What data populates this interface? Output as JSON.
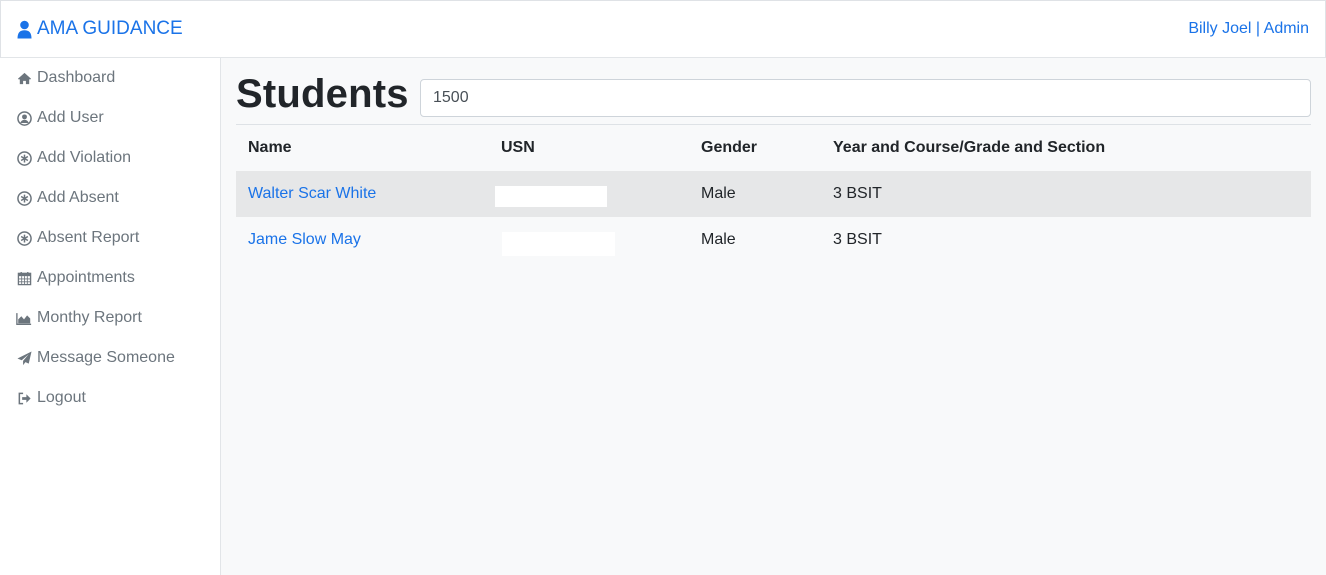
{
  "navbar": {
    "brand": "AMA GUIDANCE",
    "brand_icon": "user-icon",
    "user_name": "Billy Joel",
    "separator": " | ",
    "user_role": "Admin",
    "accent_color": "#1a73e8"
  },
  "sidebar": {
    "items": [
      {
        "label": "Dashboard",
        "icon": "home-icon"
      },
      {
        "label": "Add User",
        "icon": "user-circle-icon"
      },
      {
        "label": "Add Violation",
        "icon": "asterisk-circle-icon"
      },
      {
        "label": "Add Absent",
        "icon": "asterisk-circle-icon"
      },
      {
        "label": "Absent Report",
        "icon": "asterisk-circle-icon"
      },
      {
        "label": "Appointments",
        "icon": "calendar-icon"
      },
      {
        "label": "Monthy Report",
        "icon": "area-chart-icon"
      },
      {
        "label": "Message Someone",
        "icon": "paper-plane-icon"
      },
      {
        "label": "Logout",
        "icon": "sign-out-icon"
      }
    ]
  },
  "main": {
    "title": "Students",
    "search_value": "1500",
    "table": {
      "headers": [
        "Name",
        "USN",
        "Gender",
        "Year and Course/Grade and Section"
      ],
      "rows": [
        {
          "name": "Walter Scar White",
          "usn": "",
          "gender": "Male",
          "year_course": "3 BSIT"
        },
        {
          "name": "Jame Slow May",
          "usn": "",
          "gender": "Male",
          "year_course": "3 BSIT"
        }
      ]
    }
  }
}
